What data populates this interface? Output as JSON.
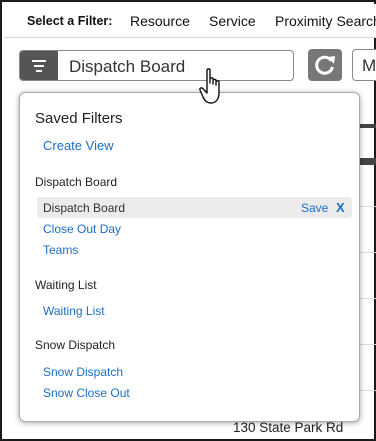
{
  "filter_bar": {
    "label": "Select a Filter:",
    "tabs": [
      "Resource",
      "Service",
      "Proximity Search"
    ]
  },
  "filter_select": {
    "value": "Dispatch Board",
    "icon": "filter-lines-icon"
  },
  "refresh_button": {
    "icon": "refresh-icon"
  },
  "second_select": {
    "value": "M"
  },
  "popup": {
    "title": "Saved Filters",
    "create_link": "Create View",
    "sections": [
      {
        "heading": "Dispatch Board",
        "items": [
          "Dispatch Board",
          "Close Out Day",
          "Teams"
        ]
      },
      {
        "heading": "Waiting List",
        "items": [
          "Waiting List"
        ]
      },
      {
        "heading": "Snow Dispatch",
        "items": [
          "Snow Dispatch",
          "Snow Close Out"
        ]
      }
    ],
    "active_row": {
      "save_label": "Save",
      "remove_label": "X"
    }
  },
  "background": {
    "address": "130 State Park Rd"
  },
  "colors": {
    "link": "#1a6fc6",
    "icon_bg": "#555555",
    "refresh_bg": "#777777",
    "active_row": "#ebebeb"
  }
}
